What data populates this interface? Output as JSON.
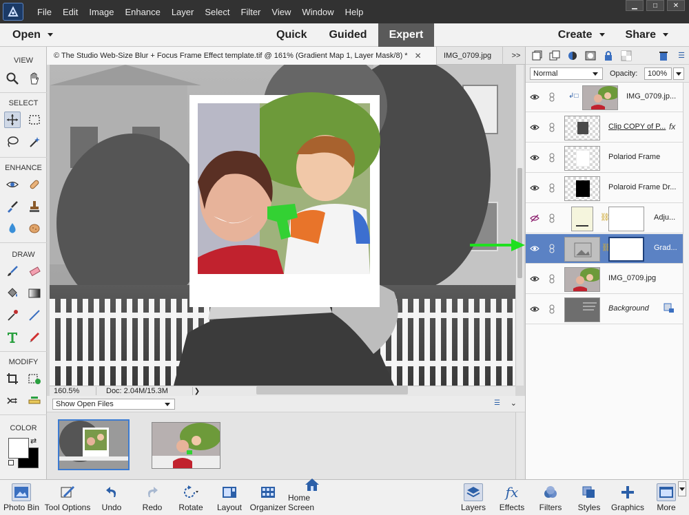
{
  "menu": {
    "items": [
      "File",
      "Edit",
      "Image",
      "Enhance",
      "Layer",
      "Select",
      "Filter",
      "View",
      "Window",
      "Help"
    ]
  },
  "modebar": {
    "open_label": "Open",
    "tabs": [
      "Quick",
      "Guided",
      "Expert"
    ],
    "active_tab": "Expert",
    "create_label": "Create",
    "share_label": "Share"
  },
  "toolbox": {
    "view_label": "VIEW",
    "select_label": "SELECT",
    "enhance_label": "ENHANCE",
    "draw_label": "DRAW",
    "modify_label": "MODIFY",
    "color_label": "COLOR"
  },
  "doc_tabs": {
    "active": "© The Studio Web-Size Blur + Focus Frame Effect template.tif @ 161% (Gradient Map 1, Layer Mask/8) *",
    "other": "IMG_0709.jpg",
    "overflow": ">>"
  },
  "status": {
    "zoom": "160.5%",
    "doc": "Doc: 2.04M/15.3M"
  },
  "photo_bin": {
    "show_label": "Show Open Files"
  },
  "layers_panel": {
    "blend_mode": "Normal",
    "opacity_label": "Opacity:",
    "opacity_value": "100%",
    "layers": [
      {
        "name": "IMG_0709.jp...",
        "kind": "photo-clipped"
      },
      {
        "name": "Clip COPY of P...",
        "kind": "fx",
        "fx": "fx"
      },
      {
        "name": "Polariod Frame",
        "kind": "white"
      },
      {
        "name": "Polaroid Frame Dr...",
        "kind": "black"
      },
      {
        "name": "Adju...",
        "kind": "adjustment-hidden"
      },
      {
        "name": "Grad...",
        "kind": "gradient-selected"
      },
      {
        "name": "IMG_0709.jpg",
        "kind": "photo"
      },
      {
        "name": "Background",
        "kind": "background"
      }
    ]
  },
  "bottom_bar": {
    "photo_bin": "Photo Bin",
    "tool_options": "Tool Options",
    "undo": "Undo",
    "redo": "Redo",
    "rotate": "Rotate",
    "layout": "Layout",
    "organizer": "Organizer",
    "home_screen": "Home Screen",
    "layers": "Layers",
    "effects": "Effects",
    "filters": "Filters",
    "styles": "Styles",
    "graphics": "Graphics",
    "more": "More"
  },
  "colors": {
    "accent": "#5b82c4",
    "arrow": "#1fe01f",
    "menubar": "#323232",
    "active_tab": "#5a5a5a"
  }
}
